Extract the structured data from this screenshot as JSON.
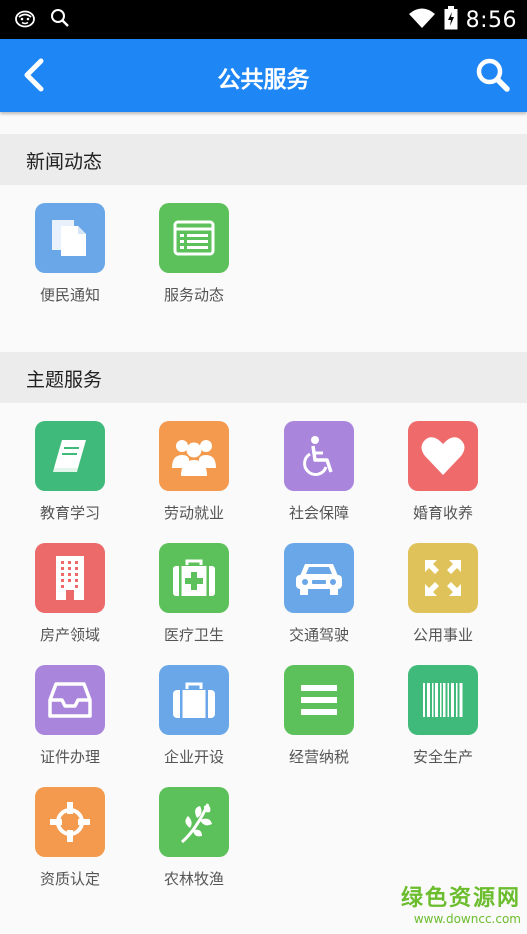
{
  "status_bar": {
    "time": "8:56"
  },
  "title_bar": {
    "title": "公共服务"
  },
  "sections": [
    {
      "title": "新闻动态"
    },
    {
      "title": "主题服务"
    }
  ],
  "news_items": [
    {
      "label": "便民通知",
      "icon": "document-icon",
      "color": "#6aa7e8"
    },
    {
      "label": "服务动态",
      "icon": "list-card-icon",
      "color": "#5cc15a"
    }
  ],
  "topic_items": [
    {
      "label": "教育学习",
      "icon": "book-icon",
      "color": "#3fba7a"
    },
    {
      "label": "劳动就业",
      "icon": "people-icon",
      "color": "#f39a4f"
    },
    {
      "label": "社会保障",
      "icon": "wheelchair-icon",
      "color": "#a985dc"
    },
    {
      "label": "婚育收养",
      "icon": "heart-icon",
      "color": "#ef6b6b"
    },
    {
      "label": "房产领域",
      "icon": "building-icon",
      "color": "#ec6a6a"
    },
    {
      "label": "医疗卫生",
      "icon": "medical-kit-icon",
      "color": "#5cc15a"
    },
    {
      "label": "交通驾驶",
      "icon": "car-icon",
      "color": "#6aa7e8"
    },
    {
      "label": "公用事业",
      "icon": "expand-arrows-icon",
      "color": "#e0c25a"
    },
    {
      "label": "证件办理",
      "icon": "inbox-tray-icon",
      "color": "#a985dc"
    },
    {
      "label": "企业开设",
      "icon": "briefcase-icon",
      "color": "#6aa7e8"
    },
    {
      "label": "经营纳税",
      "icon": "menu-lines-icon",
      "color": "#5cc15a"
    },
    {
      "label": "安全生产",
      "icon": "barcode-icon",
      "color": "#3fba7a"
    },
    {
      "label": "资质认定",
      "icon": "crosshair-icon",
      "color": "#f39a4f"
    },
    {
      "label": "农林牧渔",
      "icon": "leaf-icon",
      "color": "#5cc15a"
    }
  ],
  "watermark": {
    "title": "绿色资源网",
    "url": "www.downcc.com"
  }
}
